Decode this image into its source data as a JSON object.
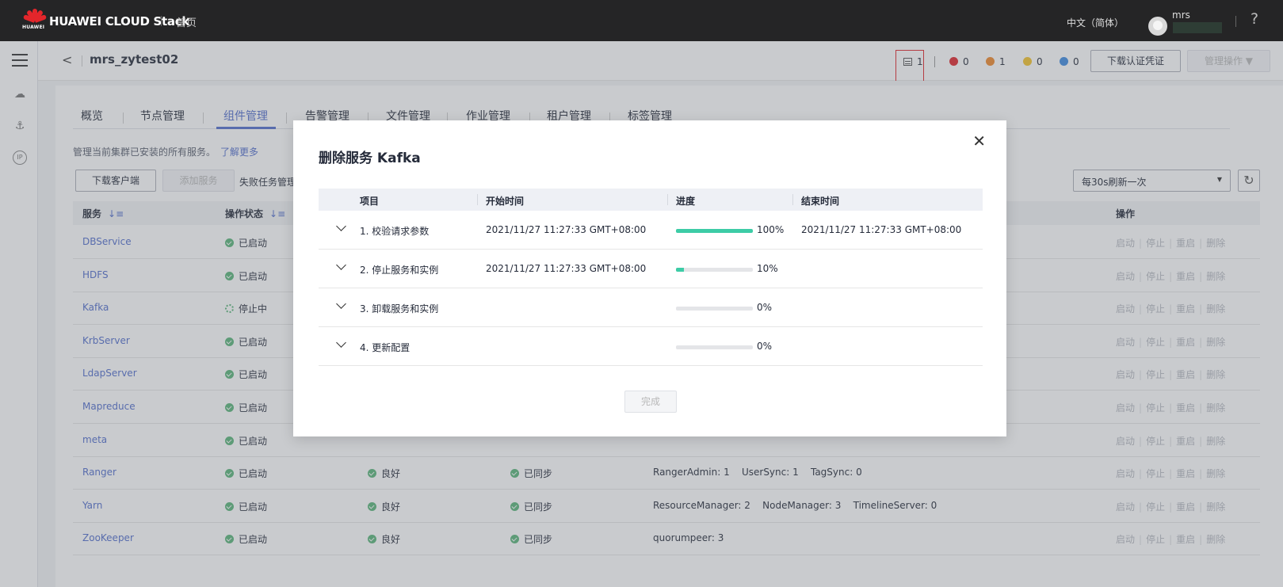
{
  "topbar": {
    "logo_caption": "HUAWEI",
    "brand": "HUAWEI CLOUD Stack",
    "home": "首页",
    "language": "中文（简体）",
    "user": "mrs",
    "help": "?"
  },
  "header": {
    "back": "<",
    "cluster_name": "mrs_zytest02",
    "task_count": "1",
    "alarms": [
      {
        "count": "0",
        "color": "#e0262b"
      },
      {
        "count": "1",
        "color": "#f0892c"
      },
      {
        "count": "0",
        "color": "#f5c32c"
      },
      {
        "count": "0",
        "color": "#3e8be0"
      }
    ],
    "download_cert": "下载认证凭证",
    "manage_ops": "管理操作 ▼"
  },
  "tabs": [
    "概览",
    "节点管理",
    "组件管理",
    "告警管理",
    "文件管理",
    "作业管理",
    "租户管理",
    "标签管理"
  ],
  "active_tab": "组件管理",
  "description": "管理当前集群已安装的所有服务。",
  "learn_more": "了解更多",
  "toolbar": {
    "download_client": "下载客户端",
    "add_service": "添加服务",
    "failed_tasks": "失败任务管理",
    "refresh_interval": "每30s刷新一次",
    "refresh_icon": "↻"
  },
  "table": {
    "headers": {
      "service": "服务",
      "op_status": "操作状态",
      "operations": "操作"
    },
    "op_labels": [
      "启动",
      "停止",
      "重启",
      "删除"
    ],
    "rows": [
      {
        "service": "DBService",
        "status": "已启动",
        "health": "",
        "config": "",
        "roles": ""
      },
      {
        "service": "HDFS",
        "status": "已启动",
        "health": "",
        "config": "",
        "roles": ""
      },
      {
        "service": "Kafka",
        "status": "停止中",
        "health": "",
        "config": "",
        "roles": ""
      },
      {
        "service": "KrbServer",
        "status": "已启动",
        "health": "",
        "config": "",
        "roles": ""
      },
      {
        "service": "LdapServer",
        "status": "已启动",
        "health": "",
        "config": "",
        "roles": ""
      },
      {
        "service": "Mapreduce",
        "status": "已启动",
        "health": "",
        "config": "",
        "roles": ""
      },
      {
        "service": "meta",
        "status": "已启动",
        "health": "",
        "config": "",
        "roles": ""
      },
      {
        "service": "Ranger",
        "status": "已启动",
        "health": "良好",
        "config": "已同步",
        "roles": "RangerAdmin: 1    UserSync: 1    TagSync: 0"
      },
      {
        "service": "Yarn",
        "status": "已启动",
        "health": "良好",
        "config": "已同步",
        "roles": "ResourceManager: 2    NodeManager: 3    TimelineServer: 0"
      },
      {
        "service": "ZooKeeper",
        "status": "已启动",
        "health": "良好",
        "config": "已同步",
        "roles": "quorumpeer: 3"
      }
    ]
  },
  "modal": {
    "title": "删除服务 Kafka",
    "close": "✕",
    "headers": {
      "item": "项目",
      "start": "开始时间",
      "progress": "进度",
      "end": "结束时间"
    },
    "steps": [
      {
        "item": "1. 校验请求参数",
        "start": "2021/11/27 11:27:33 GMT+08:00",
        "progress": 100,
        "pct": "100%",
        "end": "2021/11/27 11:27:33 GMT+08:00"
      },
      {
        "item": "2. 停止服务和实例",
        "start": "2021/11/27 11:27:33 GMT+08:00",
        "progress": 10,
        "pct": "10%",
        "end": ""
      },
      {
        "item": "3. 卸载服务和实例",
        "start": "",
        "progress": 0,
        "pct": "0%",
        "end": ""
      },
      {
        "item": "4. 更新配置",
        "start": "",
        "progress": 0,
        "pct": "0%",
        "end": ""
      }
    ],
    "done": "完成"
  }
}
